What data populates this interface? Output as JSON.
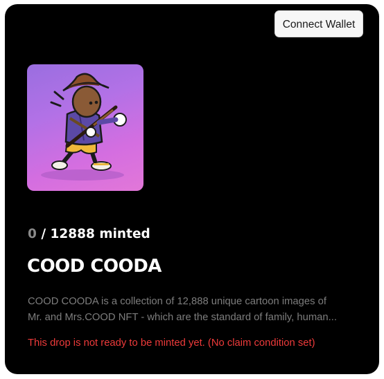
{
  "header": {
    "connect_wallet_label": "Connect Wallet"
  },
  "nft": {
    "image_icon": "cartoon-cowboy-character",
    "minted_count": "0",
    "minted_suffix": " / 12888 minted",
    "title": "COOD COODA",
    "description": "COOD COODA is a collection of 12,888 unique cartoon images of Mr. and Mrs.COOD NFT - which are the standard of family, human...",
    "status_message": "This drop is not ready to be minted yet. (No claim condition set)"
  },
  "colors": {
    "background": "#000000",
    "error": "#ee3a3a",
    "muted_text": "#7d7d7d",
    "button_bg": "#f6f6f6"
  }
}
